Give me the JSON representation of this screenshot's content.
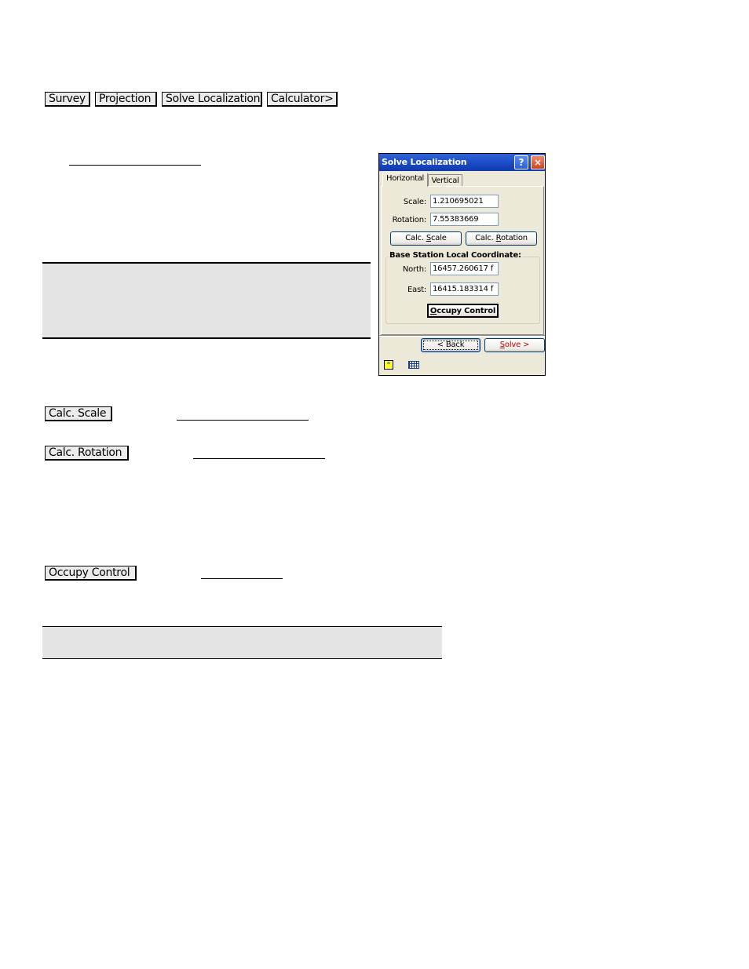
{
  "top_buttons": [
    {
      "label": "Survey"
    },
    {
      "label": "Projection"
    },
    {
      "label": "Solve Localization"
    },
    {
      "label": "Calculator>"
    }
  ],
  "inline_buttons": {
    "calc_scale": "Calc. Scale",
    "calc_rotation": "Calc. Rotation",
    "occupy_control": "Occupy Control"
  },
  "dialog": {
    "title": "Solve Localization",
    "help_glyph": "?",
    "close_glyph": "×",
    "tabs": [
      {
        "label": "Horizontal",
        "active": true
      },
      {
        "label": "Vertical",
        "active": false
      }
    ],
    "fields": {
      "scale_label": "Scale:",
      "scale_value": "1.210695021",
      "rotation_label": "Rotation:",
      "rotation_value": "7.55383669"
    },
    "buttons": {
      "calc_scale_pre": "Calc. ",
      "calc_scale_key": "S",
      "calc_scale_post": "cale",
      "calc_rotation_pre": "Calc. ",
      "calc_rotation_key": "R",
      "calc_rotation_post": "otation"
    },
    "group": {
      "legend": "Base Station Local Coordinate:",
      "north_label": "North:",
      "north_value": "16457.260617 f",
      "east_label": "East:",
      "east_value": "16415.183314 f",
      "occupy_key": "O",
      "occupy_rest": "ccupy Control"
    },
    "footer": {
      "back_label": "< Back",
      "solve_key": "S",
      "solve_rest": "olve >"
    },
    "taskbar_icons": [
      "star-icon",
      "grid-icon"
    ],
    "colors": {
      "title_bar": "#1a48c4",
      "face": "#ece9d8",
      "solve_text": "#c00000"
    }
  }
}
